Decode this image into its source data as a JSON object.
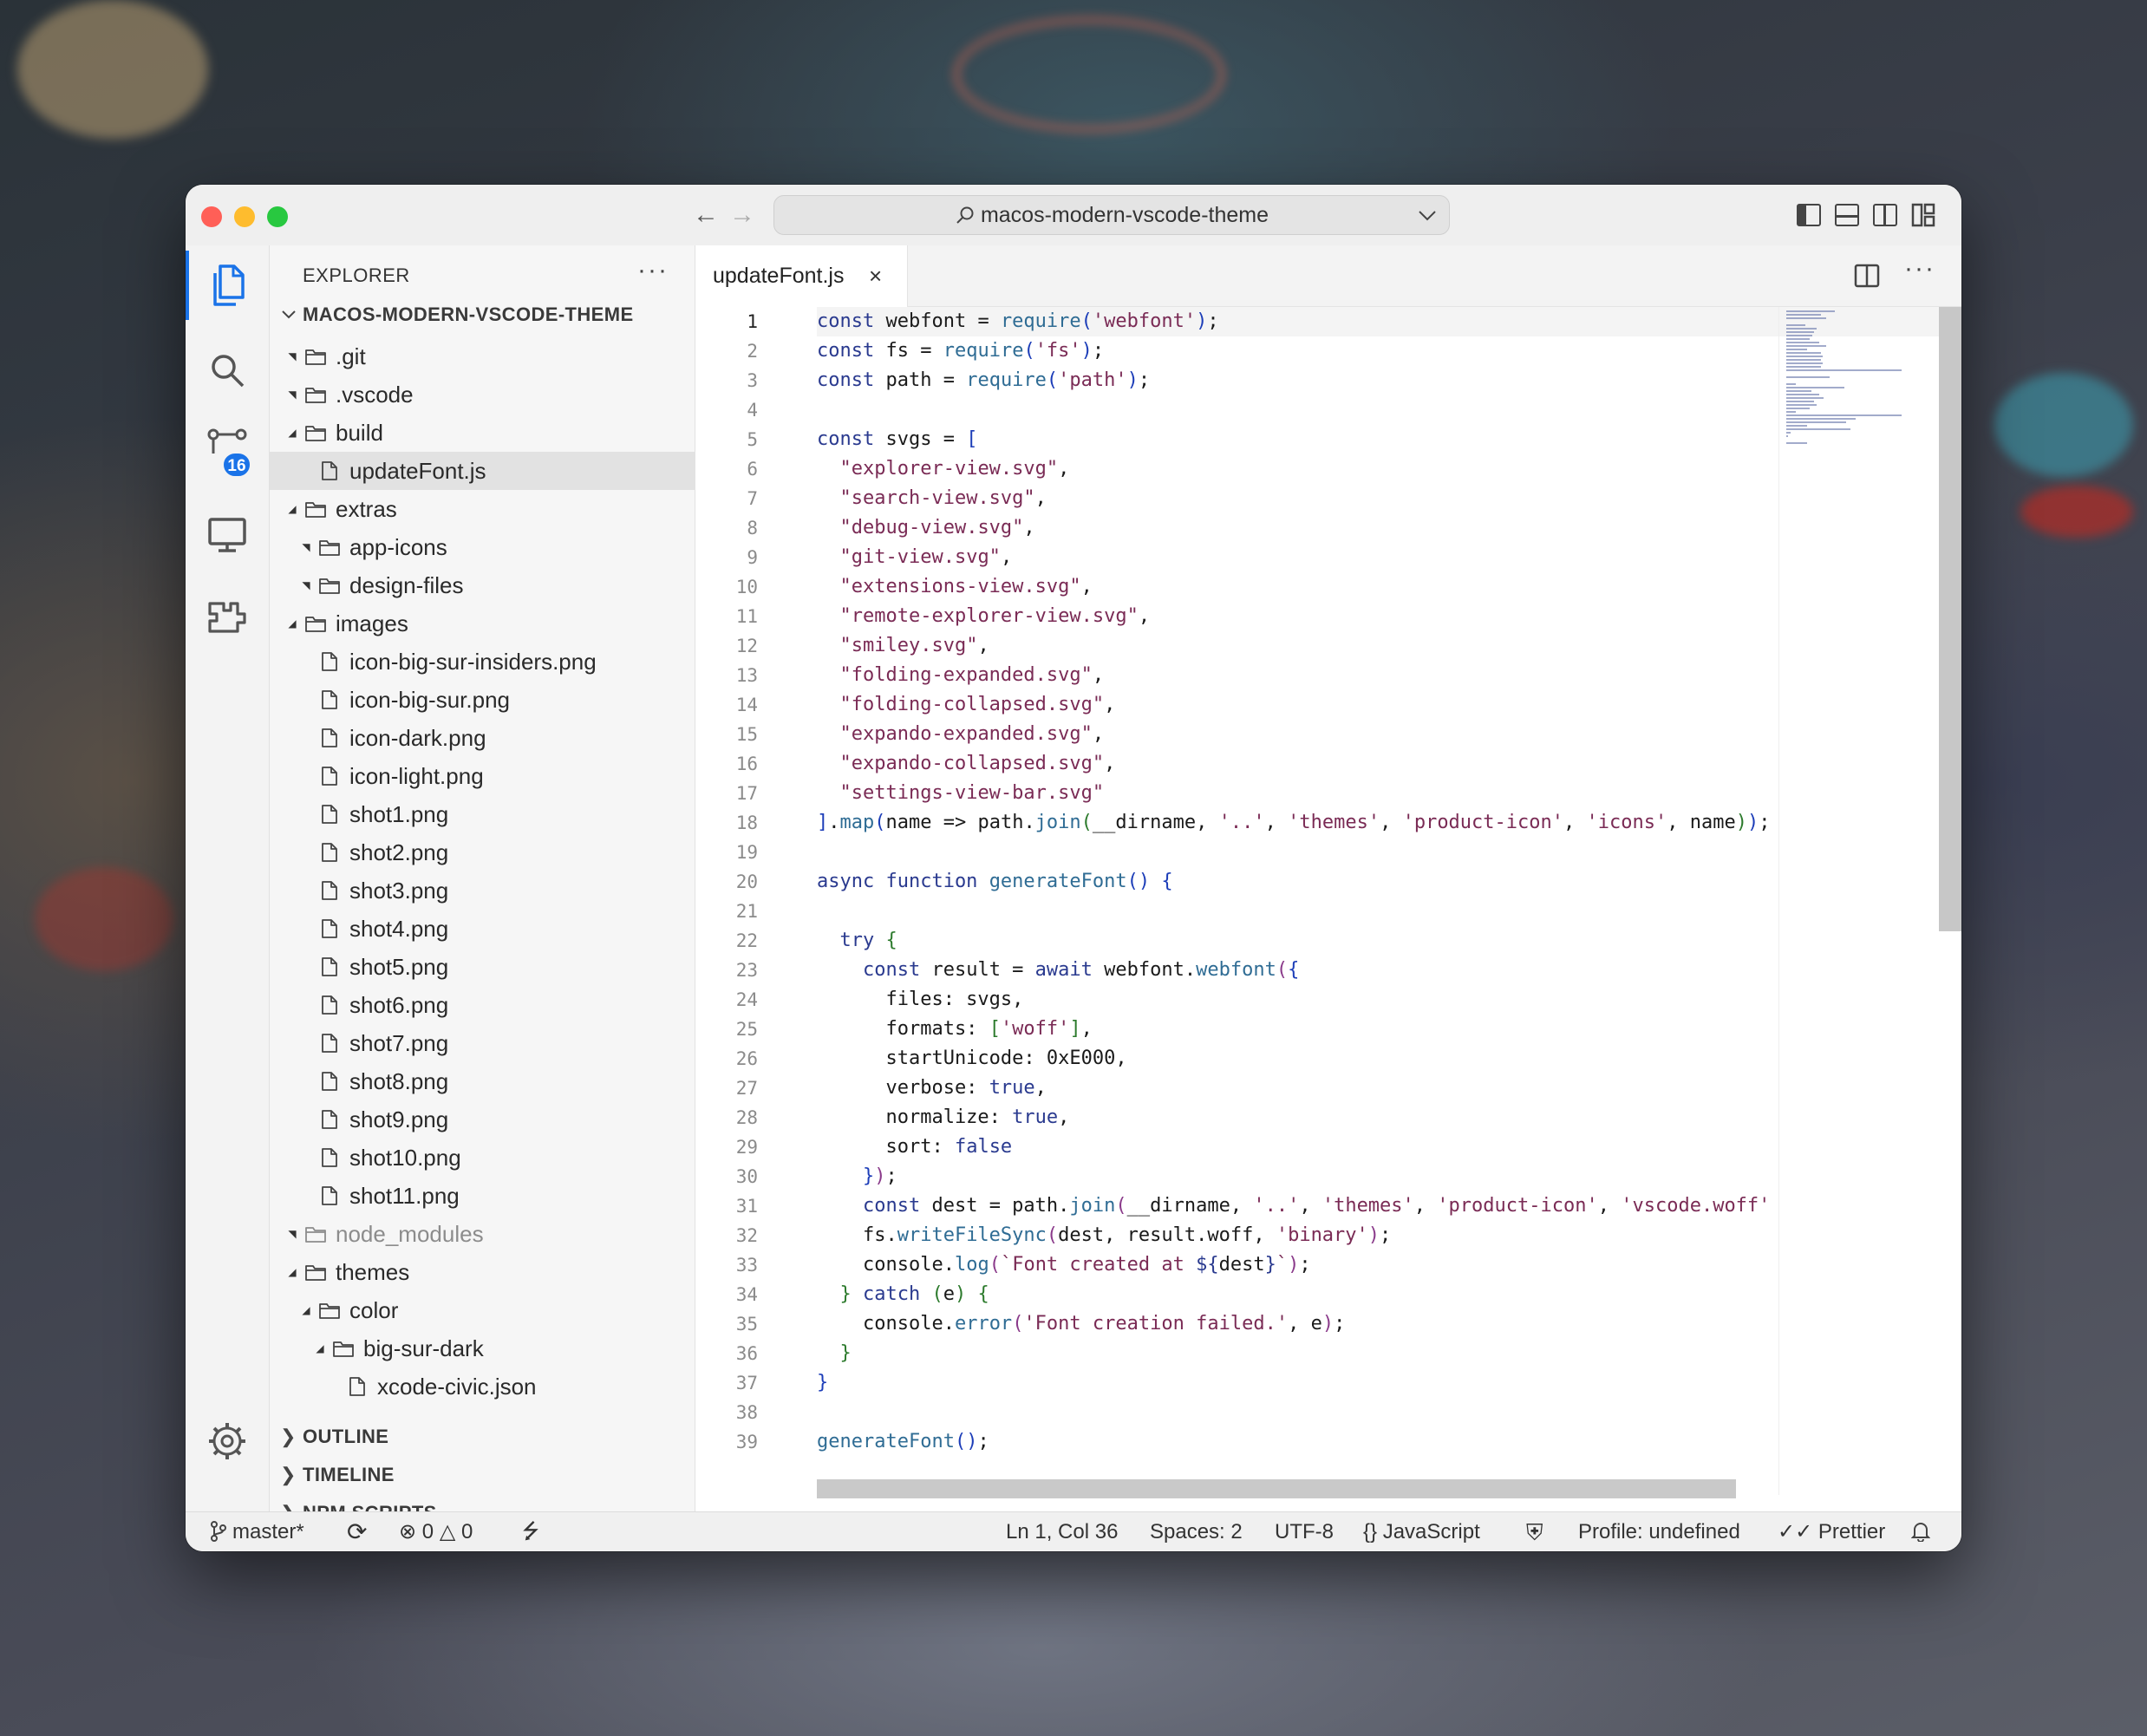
{
  "window": {
    "search_text": "macos-modern-vscode-theme",
    "traffic_colors": {
      "close": "#ff5f57",
      "minimize": "#febc2e",
      "zoom": "#28c840"
    }
  },
  "activity_bar": {
    "items": [
      "explorer-icon",
      "search-icon",
      "source-control-icon",
      "remote-explorer-icon",
      "extensions-icon"
    ],
    "source_control_badge": "16",
    "manage": "gear-icon"
  },
  "sidebar": {
    "title": "EXPLORER",
    "more": "···",
    "root": "MACOS-MODERN-VSCODE-THEME",
    "tree": [
      {
        "label": ".git",
        "type": "folder",
        "depth": 1,
        "open": false
      },
      {
        "label": ".vscode",
        "type": "folder",
        "depth": 1,
        "open": false
      },
      {
        "label": "build",
        "type": "folder",
        "depth": 1,
        "open": true
      },
      {
        "label": "updateFont.js",
        "type": "file",
        "depth": 2,
        "selected": true
      },
      {
        "label": "extras",
        "type": "folder",
        "depth": 1,
        "open": true
      },
      {
        "label": "app-icons",
        "type": "folder",
        "depth": 2,
        "open": false
      },
      {
        "label": "design-files",
        "type": "folder",
        "depth": 2,
        "open": false
      },
      {
        "label": "images",
        "type": "folder",
        "depth": 1,
        "open": true
      },
      {
        "label": "icon-big-sur-insiders.png",
        "type": "file",
        "depth": 2
      },
      {
        "label": "icon-big-sur.png",
        "type": "file",
        "depth": 2
      },
      {
        "label": "icon-dark.png",
        "type": "file",
        "depth": 2
      },
      {
        "label": "icon-light.png",
        "type": "file",
        "depth": 2
      },
      {
        "label": "shot1.png",
        "type": "file",
        "depth": 2
      },
      {
        "label": "shot2.png",
        "type": "file",
        "depth": 2
      },
      {
        "label": "shot3.png",
        "type": "file",
        "depth": 2
      },
      {
        "label": "shot4.png",
        "type": "file",
        "depth": 2
      },
      {
        "label": "shot5.png",
        "type": "file",
        "depth": 2
      },
      {
        "label": "shot6.png",
        "type": "file",
        "depth": 2
      },
      {
        "label": "shot7.png",
        "type": "file",
        "depth": 2
      },
      {
        "label": "shot8.png",
        "type": "file",
        "depth": 2
      },
      {
        "label": "shot9.png",
        "type": "file",
        "depth": 2
      },
      {
        "label": "shot10.png",
        "type": "file",
        "depth": 2
      },
      {
        "label": "shot11.png",
        "type": "file",
        "depth": 2
      },
      {
        "label": "node_modules",
        "type": "folder",
        "depth": 1,
        "open": false,
        "dim": true
      },
      {
        "label": "themes",
        "type": "folder",
        "depth": 1,
        "open": true
      },
      {
        "label": "color",
        "type": "folder",
        "depth": 2,
        "open": true
      },
      {
        "label": "big-sur-dark",
        "type": "folder",
        "depth": 3,
        "open": true
      },
      {
        "label": "xcode-civic.json",
        "type": "file",
        "depth": 4
      }
    ],
    "sections": [
      "OUTLINE",
      "TIMELINE",
      "NPM SCRIPTS"
    ]
  },
  "editor": {
    "tab_label": "updateFont.js",
    "tab_close": "×",
    "active_line": 1,
    "lines": [
      [
        [
          "k",
          "const"
        ],
        [
          "n",
          " webfont = "
        ],
        [
          "f",
          "require"
        ],
        [
          "b1",
          "("
        ],
        [
          "s",
          "'webfont'"
        ],
        [
          "b1",
          ")"
        ],
        [
          "n",
          ";"
        ]
      ],
      [
        [
          "k",
          "const"
        ],
        [
          "n",
          " fs = "
        ],
        [
          "f",
          "require"
        ],
        [
          "b1",
          "("
        ],
        [
          "s",
          "'fs'"
        ],
        [
          "b1",
          ")"
        ],
        [
          "n",
          ";"
        ]
      ],
      [
        [
          "k",
          "const"
        ],
        [
          "n",
          " path = "
        ],
        [
          "f",
          "require"
        ],
        [
          "b1",
          "("
        ],
        [
          "s",
          "'path'"
        ],
        [
          "b1",
          ")"
        ],
        [
          "n",
          ";"
        ]
      ],
      [],
      [
        [
          "k",
          "const"
        ],
        [
          "n",
          " svgs = "
        ],
        [
          "b1",
          "["
        ]
      ],
      [
        [
          "n",
          "  "
        ],
        [
          "s",
          "\"explorer-view.svg\""
        ],
        [
          "n",
          ","
        ]
      ],
      [
        [
          "n",
          "  "
        ],
        [
          "s",
          "\"search-view.svg\""
        ],
        [
          "n",
          ","
        ]
      ],
      [
        [
          "n",
          "  "
        ],
        [
          "s",
          "\"debug-view.svg\""
        ],
        [
          "n",
          ","
        ]
      ],
      [
        [
          "n",
          "  "
        ],
        [
          "s",
          "\"git-view.svg\""
        ],
        [
          "n",
          ","
        ]
      ],
      [
        [
          "n",
          "  "
        ],
        [
          "s",
          "\"extensions-view.svg\""
        ],
        [
          "n",
          ","
        ]
      ],
      [
        [
          "n",
          "  "
        ],
        [
          "s",
          "\"remote-explorer-view.svg\""
        ],
        [
          "n",
          ","
        ]
      ],
      [
        [
          "n",
          "  "
        ],
        [
          "s",
          "\"smiley.svg\""
        ],
        [
          "n",
          ","
        ]
      ],
      [
        [
          "n",
          "  "
        ],
        [
          "s",
          "\"folding-expanded.svg\""
        ],
        [
          "n",
          ","
        ]
      ],
      [
        [
          "n",
          "  "
        ],
        [
          "s",
          "\"folding-collapsed.svg\""
        ],
        [
          "n",
          ","
        ]
      ],
      [
        [
          "n",
          "  "
        ],
        [
          "s",
          "\"expando-expanded.svg\""
        ],
        [
          "n",
          ","
        ]
      ],
      [
        [
          "n",
          "  "
        ],
        [
          "s",
          "\"expando-collapsed.svg\""
        ],
        [
          "n",
          ","
        ]
      ],
      [
        [
          "n",
          "  "
        ],
        [
          "s",
          "\"settings-view-bar.svg\""
        ]
      ],
      [
        [
          "b1",
          "]"
        ],
        [
          "n",
          "."
        ],
        [
          "f",
          "map"
        ],
        [
          "b1",
          "("
        ],
        [
          "n",
          "name => path."
        ],
        [
          "f",
          "join"
        ],
        [
          "b2",
          "("
        ],
        [
          "n",
          "__dirname, "
        ],
        [
          "s",
          "'..'"
        ],
        [
          "n",
          ", "
        ],
        [
          "s",
          "'themes'"
        ],
        [
          "n",
          ", "
        ],
        [
          "s",
          "'product-icon'"
        ],
        [
          "n",
          ", "
        ],
        [
          "s",
          "'icons'"
        ],
        [
          "n",
          ", name"
        ],
        [
          "b2",
          ")"
        ],
        [
          "b1",
          ")"
        ],
        [
          "n",
          ";"
        ]
      ],
      [],
      [
        [
          "k",
          "async function"
        ],
        [
          "n",
          " "
        ],
        [
          "f",
          "generateFont"
        ],
        [
          "b1",
          "()"
        ],
        [
          "n",
          " "
        ],
        [
          "b1",
          "{"
        ]
      ],
      [],
      [
        [
          "n",
          "  "
        ],
        [
          "k",
          "try"
        ],
        [
          "n",
          " "
        ],
        [
          "b2",
          "{"
        ]
      ],
      [
        [
          "n",
          "    "
        ],
        [
          "k",
          "const"
        ],
        [
          "n",
          " result = "
        ],
        [
          "k",
          "await"
        ],
        [
          "n",
          " webfont."
        ],
        [
          "f",
          "webfont"
        ],
        [
          "b3",
          "("
        ],
        [
          "b1",
          "{"
        ]
      ],
      [
        [
          "n",
          "      files: svgs,"
        ]
      ],
      [
        [
          "n",
          "      formats: "
        ],
        [
          "b2",
          "["
        ],
        [
          "s",
          "'woff'"
        ],
        [
          "b2",
          "]"
        ],
        [
          "n",
          ","
        ]
      ],
      [
        [
          "n",
          "      startUnicode: 0xE000,"
        ]
      ],
      [
        [
          "n",
          "      verbose: "
        ],
        [
          "k",
          "true"
        ],
        [
          "n",
          ","
        ]
      ],
      [
        [
          "n",
          "      normalize: "
        ],
        [
          "k",
          "true"
        ],
        [
          "n",
          ","
        ]
      ],
      [
        [
          "n",
          "      sort: "
        ],
        [
          "k",
          "false"
        ]
      ],
      [
        [
          "n",
          "    "
        ],
        [
          "b1",
          "}"
        ],
        [
          "b3",
          ")"
        ],
        [
          "n",
          ";"
        ]
      ],
      [
        [
          "n",
          "    "
        ],
        [
          "k",
          "const"
        ],
        [
          "n",
          " dest = path."
        ],
        [
          "f",
          "join"
        ],
        [
          "b3",
          "("
        ],
        [
          "n",
          "__dirname, "
        ],
        [
          "s",
          "'..'"
        ],
        [
          "n",
          ", "
        ],
        [
          "s",
          "'themes'"
        ],
        [
          "n",
          ", "
        ],
        [
          "s",
          "'product-icon'"
        ],
        [
          "n",
          ", "
        ],
        [
          "s",
          "'vscode.woff'"
        ]
      ],
      [
        [
          "n",
          "    fs."
        ],
        [
          "f",
          "writeFileSync"
        ],
        [
          "b3",
          "("
        ],
        [
          "n",
          "dest, result.woff, "
        ],
        [
          "s",
          "'binary'"
        ],
        [
          "b3",
          ")"
        ],
        [
          "n",
          ";"
        ]
      ],
      [
        [
          "n",
          "    console."
        ],
        [
          "f",
          "log"
        ],
        [
          "b3",
          "("
        ],
        [
          "s",
          "`Font created at "
        ],
        [
          "k",
          "${"
        ],
        [
          "n",
          "dest"
        ],
        [
          "k",
          "}"
        ],
        [
          "s",
          "`"
        ],
        [
          "b3",
          ")"
        ],
        [
          "n",
          ";"
        ]
      ],
      [
        [
          "n",
          "  "
        ],
        [
          "b2",
          "}"
        ],
        [
          "n",
          " "
        ],
        [
          "k",
          "catch"
        ],
        [
          "n",
          " "
        ],
        [
          "b2",
          "("
        ],
        [
          "n",
          "e"
        ],
        [
          "b2",
          ")"
        ],
        [
          "n",
          " "
        ],
        [
          "b2",
          "{"
        ]
      ],
      [
        [
          "n",
          "    console."
        ],
        [
          "f",
          "error"
        ],
        [
          "b3",
          "("
        ],
        [
          "s",
          "'Font creation failed.'"
        ],
        [
          "n",
          ", e"
        ],
        [
          "b3",
          ")"
        ],
        [
          "n",
          ";"
        ]
      ],
      [
        [
          "n",
          "  "
        ],
        [
          "b2",
          "}"
        ]
      ],
      [
        [
          "b1",
          "}"
        ]
      ],
      [],
      [
        [
          "f",
          "generateFont"
        ],
        [
          "b1",
          "()"
        ],
        [
          "n",
          ";"
        ]
      ]
    ]
  },
  "statusbar": {
    "branch": "master*",
    "errors": "0",
    "warnings": "0",
    "position": "Ln 1, Col 36",
    "spaces": "Spaces: 2",
    "encoding": "UTF-8",
    "language": "JavaScript",
    "profile": "Profile: undefined",
    "formatter": "Prettier"
  }
}
